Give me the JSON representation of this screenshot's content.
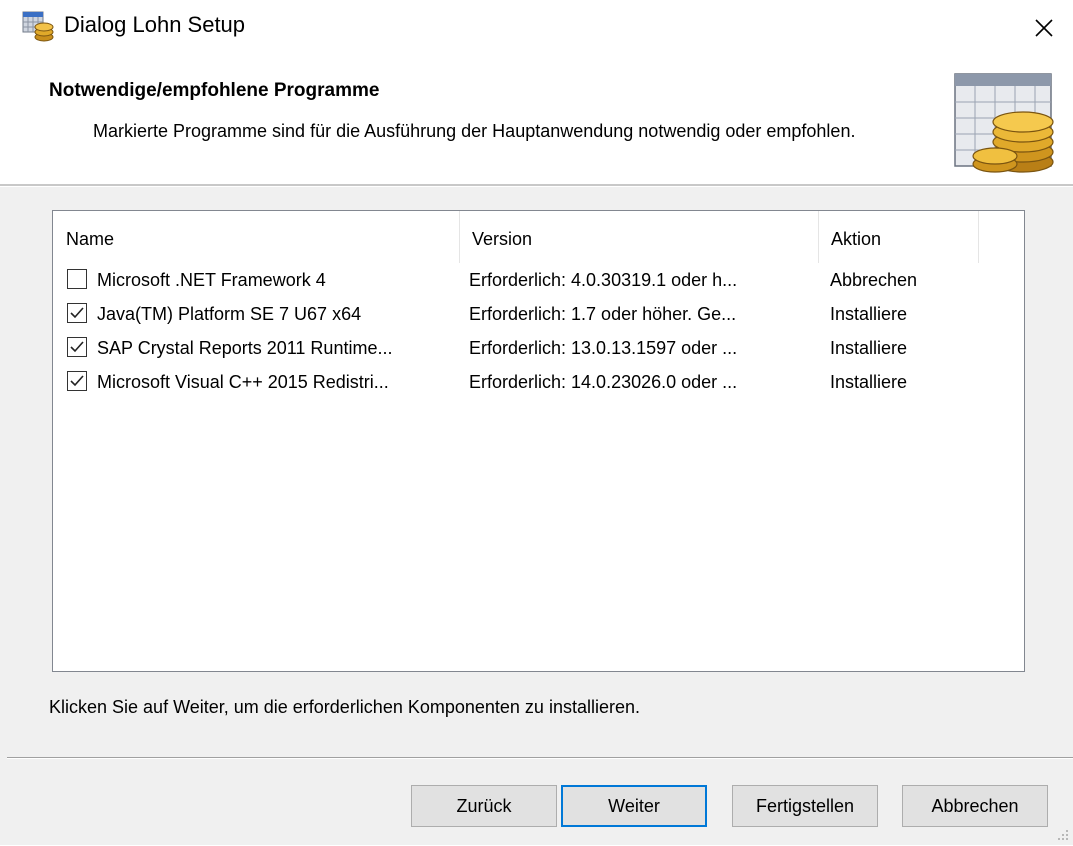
{
  "window": {
    "title": "Dialog Lohn Setup"
  },
  "header": {
    "title": "Notwendige/empfohlene Programme",
    "description": "Markierte Programme sind für die Ausführung der Hauptanwendung notwendig oder empfohlen."
  },
  "list": {
    "columns": [
      "Name",
      "Version",
      "Aktion"
    ],
    "rows": [
      {
        "checked": false,
        "name": "Microsoft .NET Framework 4",
        "version": "Erforderlich: 4.0.30319.1 oder h...",
        "action": "Abbrechen"
      },
      {
        "checked": true,
        "name": "Java(TM) Platform SE 7 U67 x64",
        "version": "Erforderlich: 1.7 oder höher. Ge...",
        "action": "Installiere"
      },
      {
        "checked": true,
        "name": "SAP Crystal Reports 2011 Runtime...",
        "version": "Erforderlich: 13.0.13.1597 oder ...",
        "action": "Installiere"
      },
      {
        "checked": true,
        "name": "Microsoft Visual C++ 2015 Redistri...",
        "version": "Erforderlich: 14.0.23026.0 oder ...",
        "action": "Installiere"
      }
    ]
  },
  "info_text": "Klicken Sie auf Weiter, um die erforderlichen Komponenten zu installieren.",
  "buttons": {
    "back": "Zurück",
    "next": "Weiter",
    "finish": "Fertigstellen",
    "cancel": "Abbrechen"
  },
  "colors": {
    "accent": "#0078d7",
    "button_bg": "#e1e1e1",
    "dialog_bg": "#f0f0f0"
  },
  "icons": {
    "app": "setup-coins-icon",
    "close": "close-icon",
    "logo": "coins-calculator-icon",
    "checkmark": "checkmark-icon",
    "grip": "resize-grip-icon"
  }
}
